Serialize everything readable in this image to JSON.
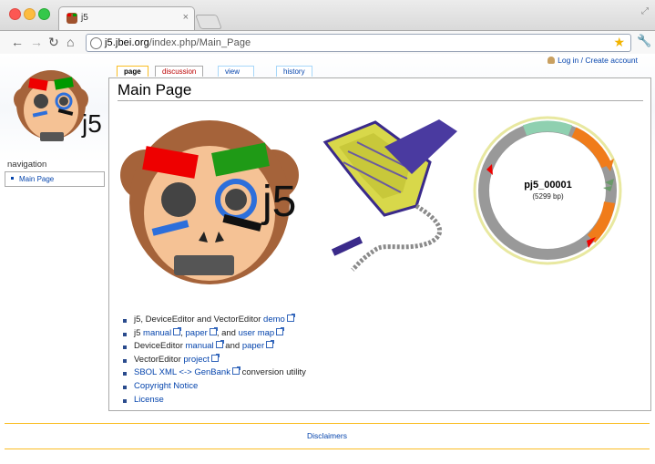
{
  "browser": {
    "tab_title": "j5",
    "tab_close_glyph": "×",
    "url_host": "j5.jbei.org",
    "url_path": "/index.php/Main_Page",
    "icons": {
      "back": "back-arrow-icon",
      "forward": "forward-arrow-icon",
      "reload": "reload-icon",
      "home": "home-icon",
      "bookmark": "star-icon",
      "settings": "wrench-icon"
    }
  },
  "wiki": {
    "user_links": "Log in / Create account",
    "tabs": [
      {
        "label": "page"
      },
      {
        "label": "discussion"
      },
      {
        "label": "view source"
      },
      {
        "label": "history"
      }
    ],
    "navigation": {
      "title": "navigation",
      "items": [
        {
          "label": "Main Page"
        }
      ]
    },
    "page_title": "Main Page",
    "logo_text": "j5",
    "hero_text": "j5",
    "plasmid": {
      "name": "pj5_00001",
      "length": "(5299 bp)"
    },
    "links": [
      {
        "text": "j5, DeviceEditor and VectorEditor ",
        "link": "demo"
      },
      {
        "text": "j5 ",
        "link1": "manual",
        "sep1": ", ",
        "link2": "paper",
        "sep2": ", and ",
        "link3": "user map"
      },
      {
        "text": "DeviceEditor ",
        "link1": "manual",
        "sep": " and ",
        "link2": "paper"
      },
      {
        "text": "VectorEditor ",
        "link": "project"
      },
      {
        "link": "SBOL XML <-> GenBank",
        "text": " conversion utility"
      },
      {
        "link": "Copyright Notice"
      },
      {
        "link": "License"
      }
    ],
    "footer": {
      "link": "Disclaimers"
    }
  }
}
